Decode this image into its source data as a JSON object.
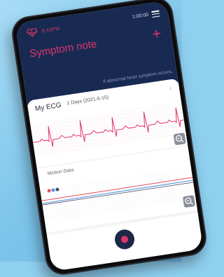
{
  "status": {
    "time": "8:43PM",
    "timer": "1:00:00"
  },
  "header": {
    "title": "Symptom note",
    "notice": "If abnormal heart symptom occurs,"
  },
  "ecg": {
    "title": "My ECG",
    "subtitle": "1 Days (2021-6-15)"
  },
  "motion": {
    "title": "Motion Data"
  },
  "colors": {
    "accent": "#e0356a",
    "navy": "#182a52"
  }
}
